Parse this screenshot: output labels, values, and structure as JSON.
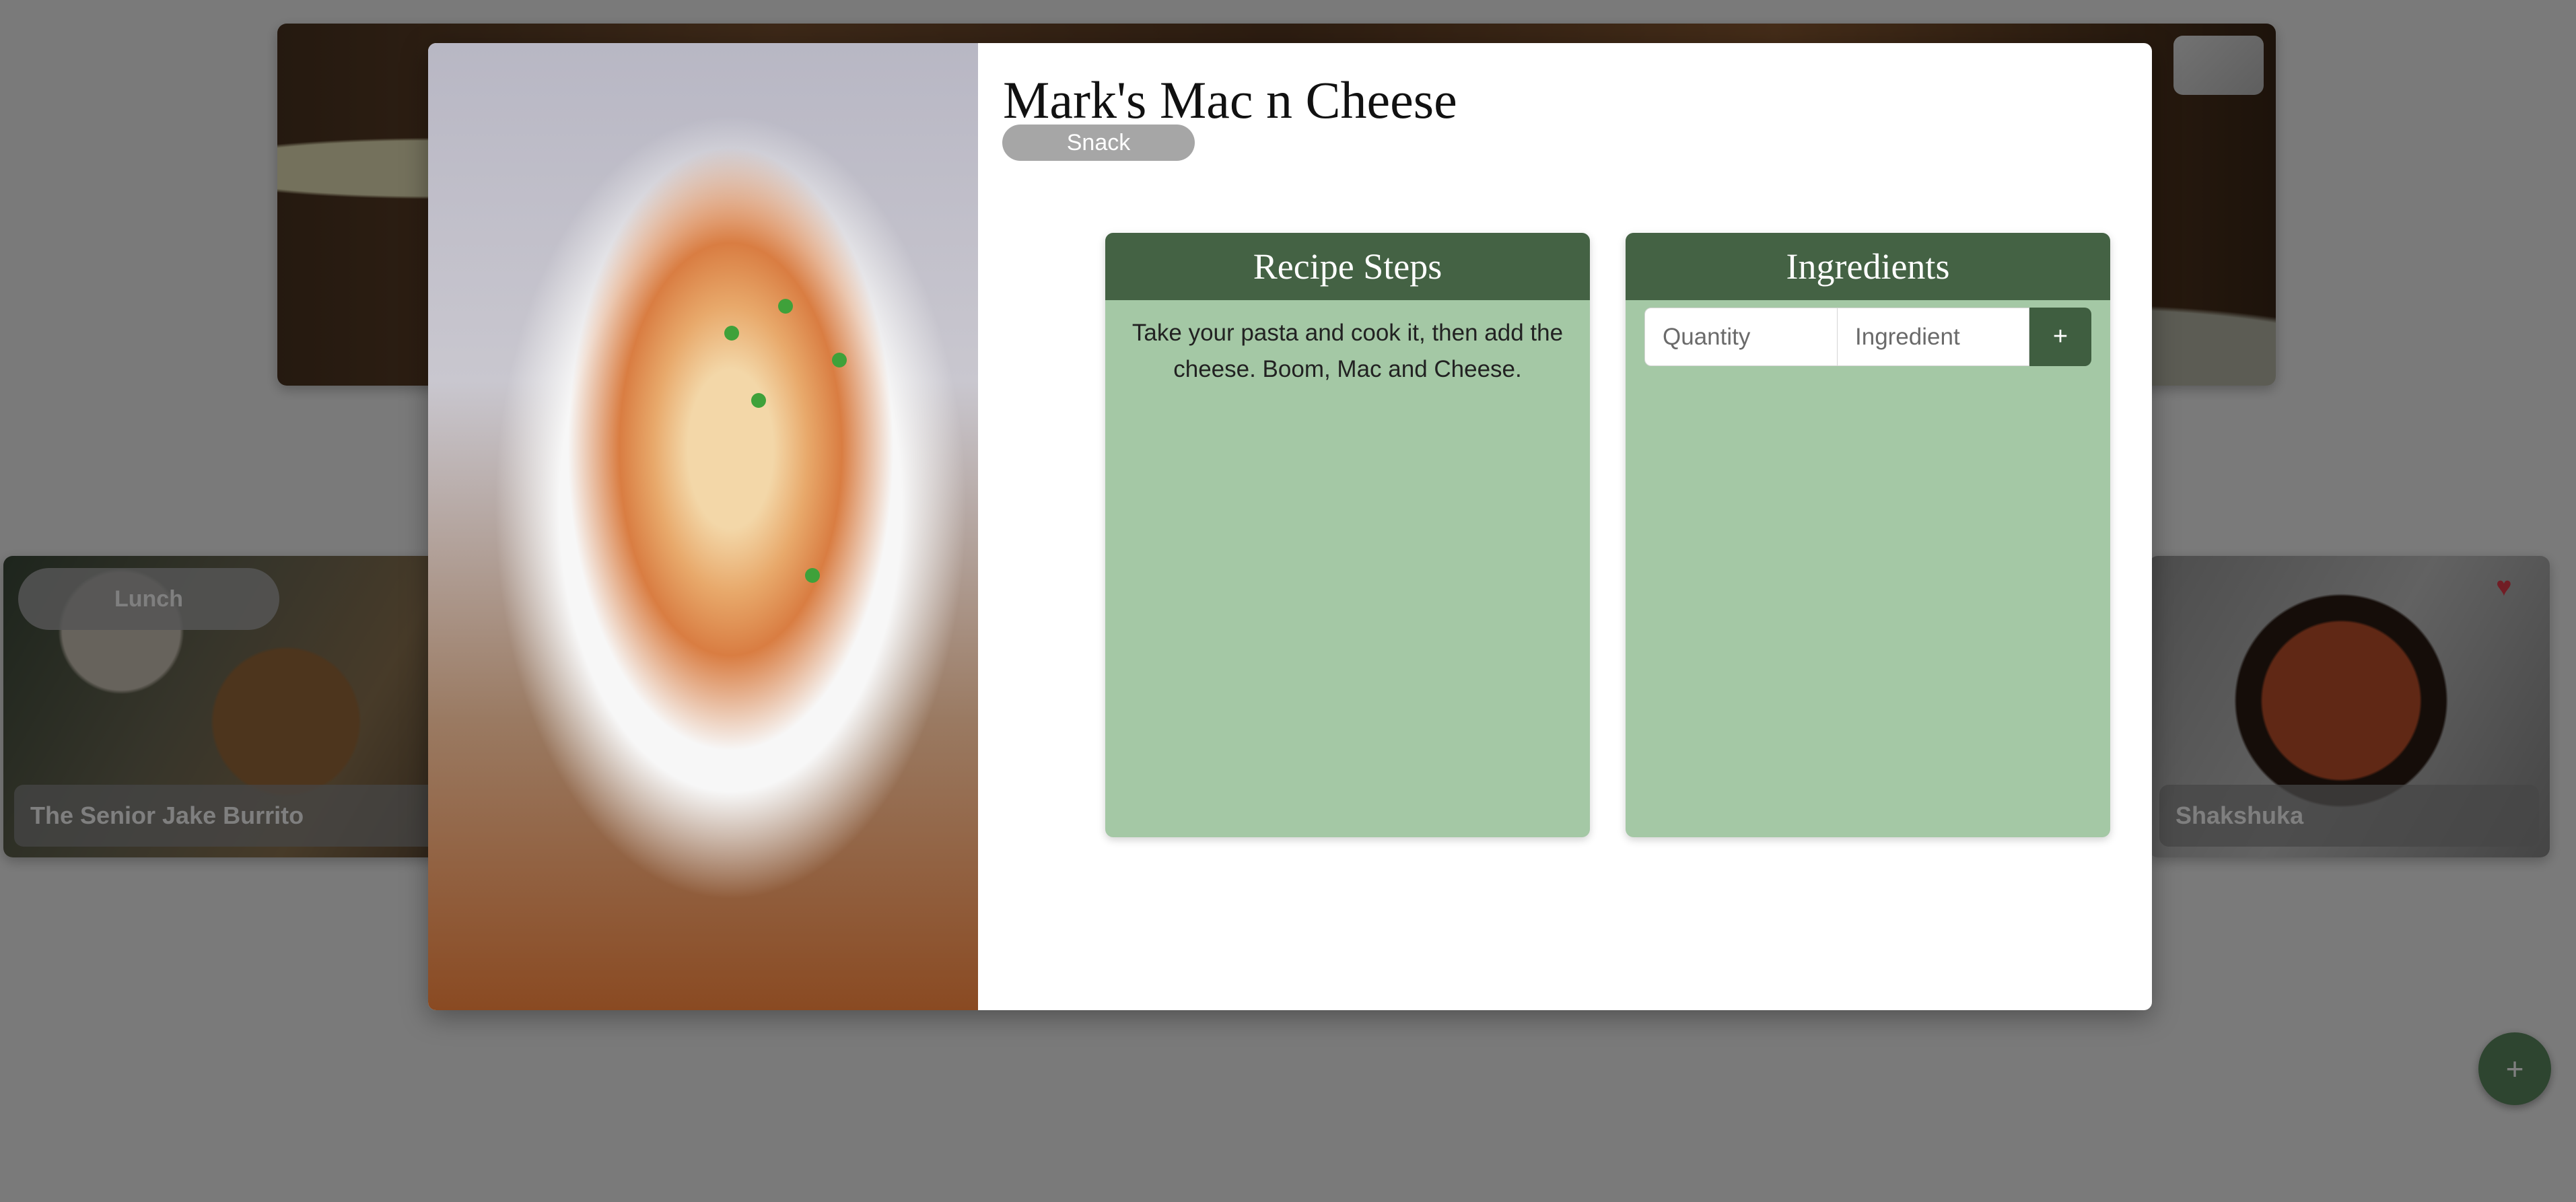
{
  "background": {
    "left_card": {
      "badge": "Lunch",
      "title": "The Senior Jake Burrito"
    },
    "right_card": {
      "title": "Shakshuka",
      "favorite_icon": "heart-icon"
    },
    "fab_label": "+"
  },
  "modal": {
    "title": "Mark's Mac n Cheese",
    "category": "Snack",
    "steps_panel": {
      "header": "Recipe Steps",
      "text": "Take your pasta and cook it, then add the cheese. Boom, Mac and Cheese."
    },
    "ingredients_panel": {
      "header": "Ingredients",
      "quantity_placeholder": "Quantity",
      "ingredient_placeholder": "Ingredient",
      "add_label": "+"
    }
  },
  "colors": {
    "panel_header": "#446244",
    "panel_body": "#a4c8a5",
    "badge": "#a6a6a6",
    "overlay": "rgba(0,0,0,0.5)"
  }
}
